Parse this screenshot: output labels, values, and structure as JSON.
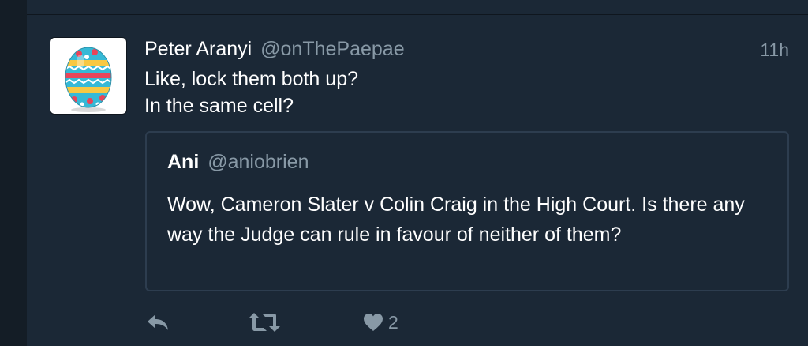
{
  "tweet": {
    "author_name": "Peter Aranyi",
    "author_handle": "@onThePaepae",
    "timestamp": "11h",
    "text_lines": [
      "Like, lock them both up?",
      "In the same cell?"
    ],
    "avatar_icon": "easter-egg-icon"
  },
  "quote": {
    "author_name": "Ani",
    "author_handle": "@aniobrien",
    "text": "Wow, Cameron Slater v Colin Craig in the High Court. Is there any way the Judge can rule in favour of neither of them?"
  },
  "actions": {
    "reply_icon": "reply-icon",
    "retweet_icon": "retweet-icon",
    "like_icon": "heart-icon",
    "like_count": "2"
  },
  "colors": {
    "background": "#141d26",
    "column": "#1b2836",
    "text": "#ffffff",
    "muted": "#8899a6",
    "border": "#2d3d4f"
  }
}
